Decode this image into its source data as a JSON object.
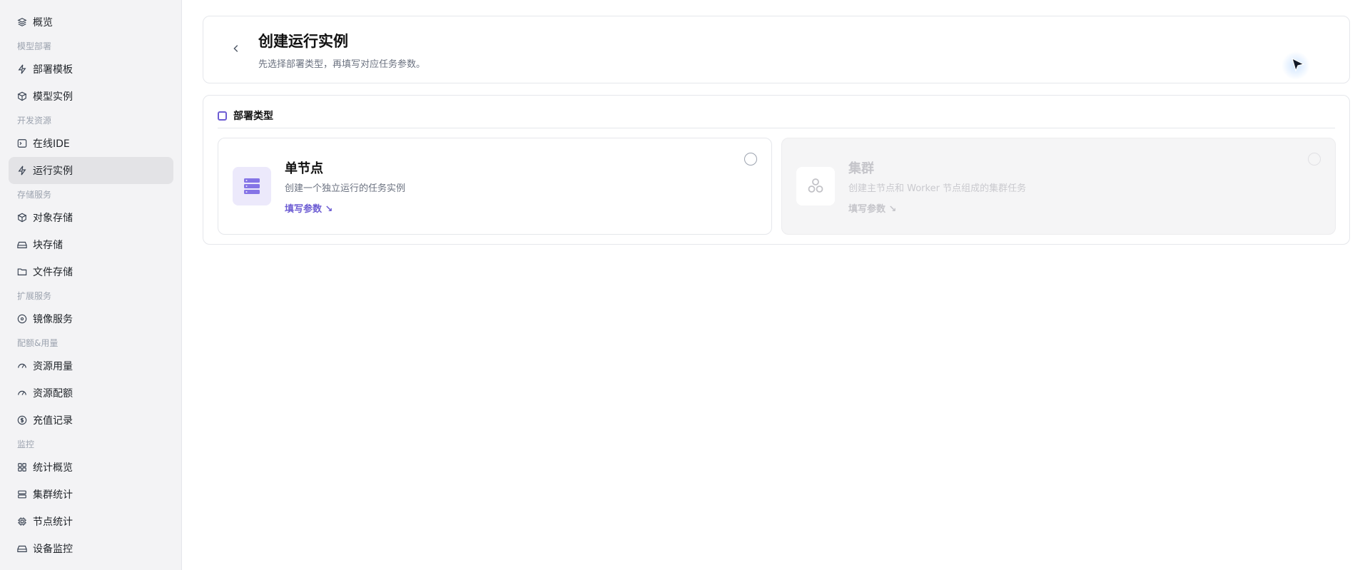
{
  "sidebar": {
    "items": [
      {
        "label": "概览",
        "icon": "layers-icon"
      },
      {
        "label": "部署模板",
        "icon": "lightning-icon"
      },
      {
        "label": "模型实例",
        "icon": "cube-icon"
      },
      {
        "label": "在线IDE",
        "icon": "terminal-icon"
      },
      {
        "label": "运行实例",
        "icon": "lightning-icon",
        "active": true
      },
      {
        "label": "对象存储",
        "icon": "box-icon"
      },
      {
        "label": "块存储",
        "icon": "drive-icon"
      },
      {
        "label": "文件存储",
        "icon": "folder-icon"
      },
      {
        "label": "镜像服务",
        "icon": "disc-icon"
      },
      {
        "label": "资源用量",
        "icon": "gauge-icon"
      },
      {
        "label": "资源配额",
        "icon": "gauge-icon"
      },
      {
        "label": "充值记录",
        "icon": "dollar-circle-icon"
      },
      {
        "label": "统计概览",
        "icon": "grid-icon"
      },
      {
        "label": "集群统计",
        "icon": "server-icon"
      },
      {
        "label": "节点统计",
        "icon": "chip-icon"
      },
      {
        "label": "设备监控",
        "icon": "drive-icon"
      }
    ],
    "sections": [
      "模型部署",
      "开发资源",
      "存储服务",
      "扩展服务",
      "配额&用量",
      "监控"
    ]
  },
  "header": {
    "title": "创建运行实例",
    "subtitle": "先选择部署类型，再填写对应任务参数。"
  },
  "deploy": {
    "section_title": "部署类型",
    "options": [
      {
        "title": "单节点",
        "desc": "创建一个独立运行的任务实例",
        "link": "填写参数 ↘",
        "icon": "server-stack-icon",
        "disabled": false
      },
      {
        "title": "集群",
        "desc": "创建主节点和 Worker 节点组成的集群任务",
        "link": "填写参数 ↘",
        "icon": "cluster-icon",
        "disabled": true
      }
    ]
  },
  "colors": {
    "accent": "#6d5dd3",
    "sidebar_bg": "#f3f3f5",
    "active_item_bg": "#e3e3e6"
  }
}
